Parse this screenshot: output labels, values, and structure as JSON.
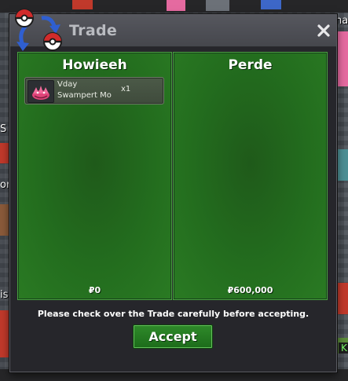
{
  "trade": {
    "title": "Trade",
    "close_glyph": "×",
    "left": {
      "player_name": "Howieeh",
      "money": "₽0",
      "items": [
        {
          "name_line1": "Vday",
          "name_line2": "Swampert Mo",
          "quantity": "x1",
          "icon": "swampert-mount-icon"
        }
      ]
    },
    "right": {
      "player_name": "Perde",
      "money": "₽600,000"
    },
    "note": "Please check over the Trade carefully before accepting.",
    "accept_label": "Accept"
  },
  "background": {
    "left_edge_labels": [
      "S",
      "or",
      "is"
    ],
    "right_edge_label_top": "nal",
    "right_edge_label_bottom": "K",
    "accent_colors": {
      "panel_green": "#236d1e",
      "accept_green": "#2f8a2a",
      "window_dark": "#26262b"
    }
  }
}
